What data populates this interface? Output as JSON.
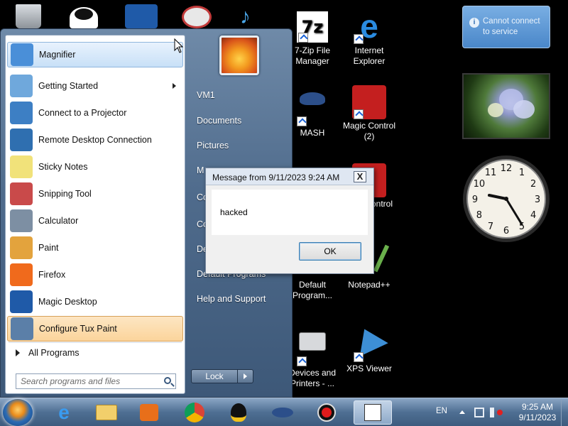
{
  "desktop_icons": [
    {
      "label": "7-Zip File Manager",
      "icon": "7zip-icon"
    },
    {
      "label": "Internet Explorer",
      "icon": "internet-explorer-icon"
    },
    {
      "label": "MASH",
      "icon": "mash-icon"
    },
    {
      "label": "Magic Control (2)",
      "icon": "magic-control-icon"
    },
    {
      "label": "ontrol",
      "icon": "magic-control-icon"
    },
    {
      "label": "Default Program...",
      "icon": "default-programs-icon"
    },
    {
      "label": "Notepad++",
      "icon": "notepad-plus-plus-icon"
    },
    {
      "label": "Devices and Printers - ...",
      "icon": "printer-icon"
    },
    {
      "label": "XPS Viewer",
      "icon": "xps-viewer-icon"
    }
  ],
  "start_menu": {
    "programs": [
      {
        "label": "Magnifier",
        "icon": "magnifier-icon"
      },
      {
        "label": "Getting Started",
        "icon": "getting-started-icon"
      },
      {
        "label": "Connect to a Projector",
        "icon": "projector-icon"
      },
      {
        "label": "Remote Desktop Connection",
        "icon": "remote-desktop-icon"
      },
      {
        "label": "Sticky Notes",
        "icon": "sticky-notes-icon"
      },
      {
        "label": "Snipping Tool",
        "icon": "snipping-tool-icon"
      },
      {
        "label": "Calculator",
        "icon": "calculator-icon"
      },
      {
        "label": "Paint",
        "icon": "paint-icon"
      },
      {
        "label": "Firefox",
        "icon": "firefox-icon"
      },
      {
        "label": "Magic Desktop",
        "icon": "magic-desktop-icon"
      },
      {
        "label": "Configure Tux Paint",
        "icon": "tux-paint-config-icon"
      }
    ],
    "all_programs_label": "All Programs",
    "search_placeholder": "Search programs and files",
    "right_links": [
      "VM1",
      "Documents",
      "Pictures",
      "M",
      "Co",
      "Co",
      "De",
      "Default Programs",
      "Help and Support"
    ],
    "lock_label": "Lock"
  },
  "dialog": {
    "title": "Message from  9/11/2023 9:24 AM",
    "close": "X",
    "message": "hacked",
    "ok_label": "OK"
  },
  "gadgets": {
    "notice": "Cannot connect to service",
    "info_glyph": "i",
    "clock_numbers": [
      "12",
      "1",
      "2",
      "3",
      "4",
      "5",
      "6",
      "7",
      "8",
      "9",
      "10",
      "11"
    ]
  },
  "taskbar": {
    "pinned": [
      "internet-explorer-icon",
      "windows-explorer-icon",
      "media-player-icon",
      "chrome-icon",
      "tux-icon",
      "mash-icon",
      "record-icon",
      "notepad-window-icon"
    ],
    "language": "EN",
    "time": "9:25 AM",
    "date": "9/11/2023"
  }
}
